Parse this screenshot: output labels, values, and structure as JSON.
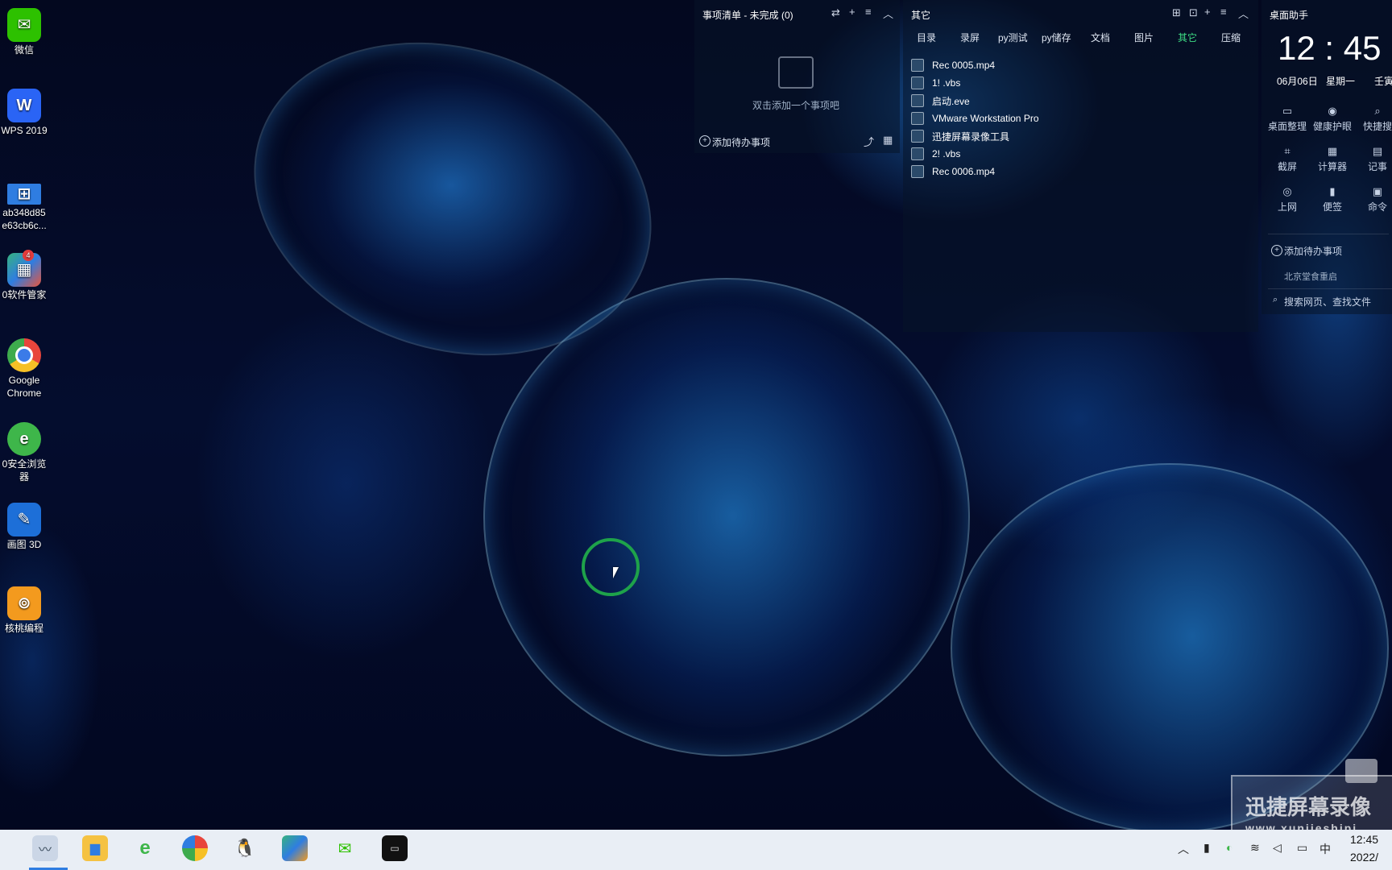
{
  "desktop_icons": [
    {
      "label": "微信",
      "icon": "wechat-icon",
      "color": "#2dc100"
    },
    {
      "label": "WPS 2019",
      "icon": "wps-icon",
      "color": "#2a64f5"
    },
    {
      "label": "ab348d85\ne63cb6c...",
      "icon": "windows-file-icon",
      "color": "#2f7de1"
    },
    {
      "label": "0软件管家",
      "icon": "software-manager-icon",
      "color": "#36b37e",
      "badge": "4"
    },
    {
      "label": "Google\nChrome",
      "icon": "chrome-icon",
      "color": "#e8453c"
    },
    {
      "label": "0安全浏览\n器",
      "icon": "browser-icon",
      "color": "#3eb64a"
    },
    {
      "label": "画图 3D",
      "icon": "paint3d-icon",
      "color": "#1d6fd8"
    },
    {
      "label": "核桃编程",
      "icon": "walnut-coding-icon",
      "color": "#f39a1e"
    }
  ],
  "todo_panel": {
    "title": "事项清单 - 未完成 (0)",
    "empty_hint": "双击添加一个事项吧",
    "add_label": "添加待办事项"
  },
  "files_panel": {
    "title": "其它",
    "tabs": [
      "目录",
      "录屏",
      "py测试",
      "py储存",
      "文档",
      "图片",
      "其它",
      "压缩"
    ],
    "active_tab": "其它",
    "files": [
      "Rec 0005.mp4",
      "1! .vbs",
      "启动.eve",
      "VMware Workstation Pro",
      "迅捷屏幕录像工具",
      "2! .vbs",
      "Rec 0006.mp4"
    ]
  },
  "assistant_panel": {
    "title": "桌面助手",
    "time": "12 : 45",
    "date": "06月06日",
    "weekday": "星期一",
    "lunar": "壬寅",
    "tools": [
      {
        "label": "桌面整理",
        "icon": "monitor-icon"
      },
      {
        "label": "健康护眼",
        "icon": "eye-icon"
      },
      {
        "label": "快捷搜",
        "icon": "search-icon"
      },
      {
        "label": "截屏",
        "icon": "crop-icon"
      },
      {
        "label": "计算器",
        "icon": "calculator-icon"
      },
      {
        "label": "记事",
        "icon": "note-icon"
      },
      {
        "label": "上网",
        "icon": "globe-icon"
      },
      {
        "label": "便签",
        "icon": "sticky-note-icon"
      },
      {
        "label": "命令",
        "icon": "terminal-icon"
      }
    ],
    "add_todo": "添加待办事项",
    "news": "北京堂食重启",
    "search_placeholder": "搜索网页、查找文件"
  },
  "watermark": {
    "title": "迅捷屏幕录像",
    "url": "www.xunjieshipi"
  },
  "taskbar": {
    "apps": [
      "task-manager-icon",
      "file-explorer-icon",
      "ie-browser-icon",
      "360-browser-icon",
      "qq-icon",
      "software-store-icon",
      "wechat-icon",
      "terminal-icon"
    ],
    "clock_time": "12:45",
    "clock_date": "2022/"
  }
}
